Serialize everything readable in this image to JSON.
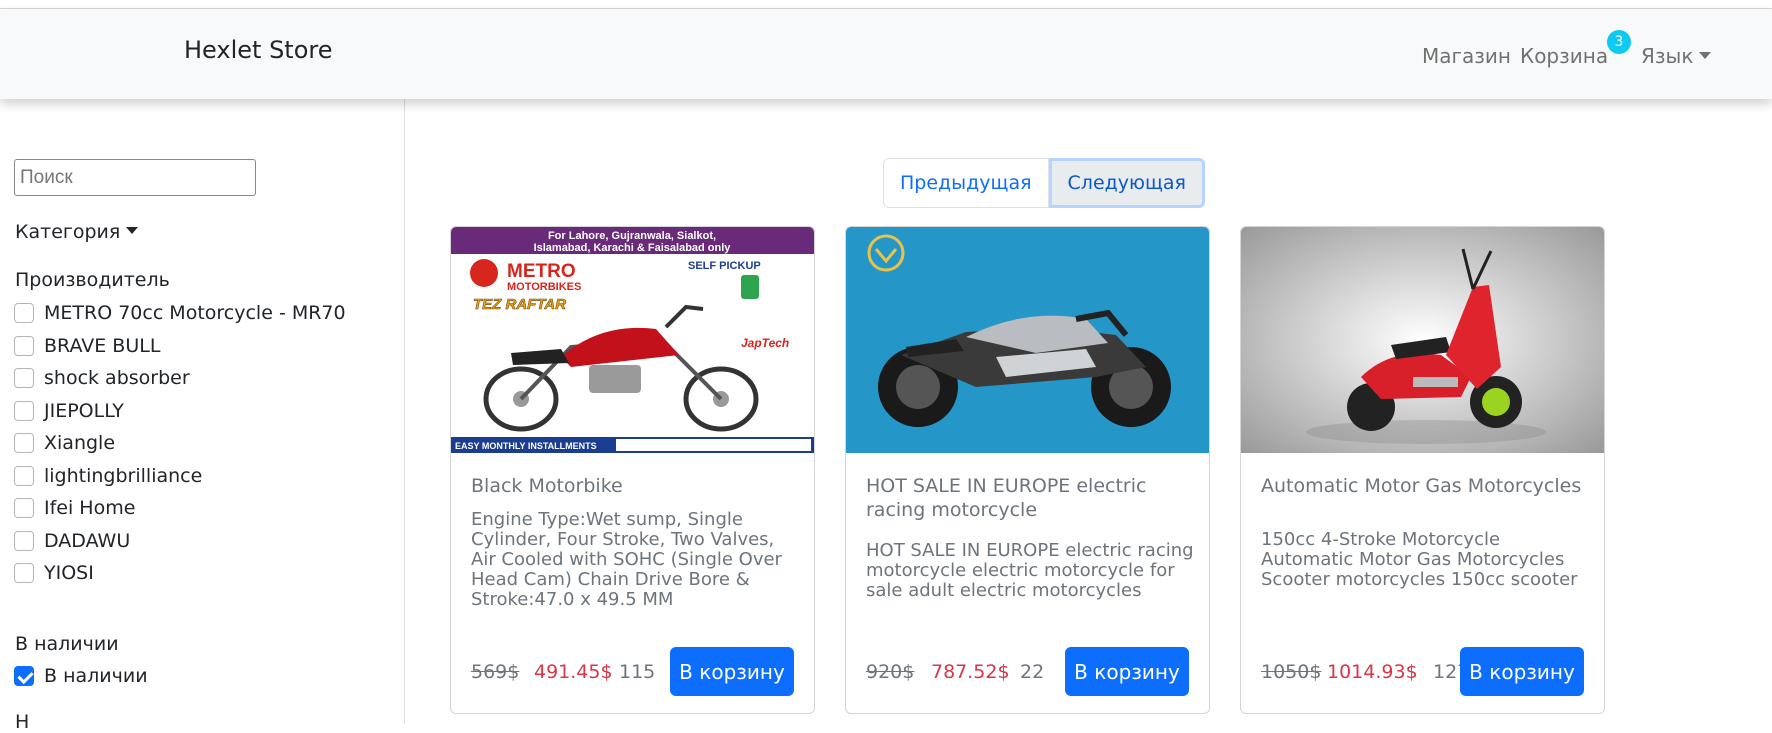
{
  "navbar": {
    "brand": "Hexlet Store",
    "shop": "Магазин",
    "cart": "Корзина",
    "cart_count": "3",
    "language": "Язык"
  },
  "sidebar": {
    "search_placeholder": "Поиск",
    "category": "Категория",
    "maker_heading": "Производитель",
    "makers": [
      "METRO 70cc Motorcycle - MR70",
      "BRAVE BULL",
      "shock absorber",
      "JIEPOLLY",
      "Xiangle",
      "lightingbrilliance",
      "Ifei Home",
      "DADAWU",
      "YIOSI"
    ],
    "stock_heading": "В наличии",
    "stock_option": "В наличии",
    "next_heading": "Н"
  },
  "pagination": {
    "prev": "Предыдущая",
    "next": "Следующая"
  },
  "products": [
    {
      "title": "Black Motorbike",
      "description": "Engine Type:Wet sump, Single Cylinder, Four Stroke, Two Valves, Air Cooled with SOHC (Single Over Head Cam) Chain Drive Bore & Stroke:47.0 x 49.5 MM",
      "old_price": "569$",
      "price": "491.45$",
      "quantity": "115",
      "button": "В корзину",
      "image": {
        "banner1": "For Lahore, Gujranwala, Sialkot,",
        "banner2": "Islamabad, Karachi & Faisalabad only",
        "brand1": "METRO",
        "brand2": "MOTORBIKES",
        "pickup": "SELF PICKUP",
        "model": "TEZ RAFTAR",
        "installments": "EASY MONTHLY INSTALLMENTS",
        "japtech": "JapTech"
      }
    },
    {
      "title": "HOT SALE IN EUROPE electric racing motorcycle",
      "description": "HOT SALE IN EUROPE electric racing motorcycle electric motorcycle for sale adult electric motorcycles",
      "old_price": "920$",
      "price": "787.52$",
      "quantity": "22",
      "button": "В корзину"
    },
    {
      "title": "Automatic Motor Gas Motorcycles",
      "description": "150cc 4-Stroke Motorcycle Automatic Motor Gas Motorcycles Scooter motorcycles 150cc scooter",
      "old_price": "1050$",
      "price": "1014.93$",
      "quantity": "127",
      "button": "В корзину"
    }
  ],
  "colors": {
    "primary": "#0d6efd",
    "danger": "#dc3545",
    "info": "#0dcaf0",
    "muted": "#6c757d"
  }
}
